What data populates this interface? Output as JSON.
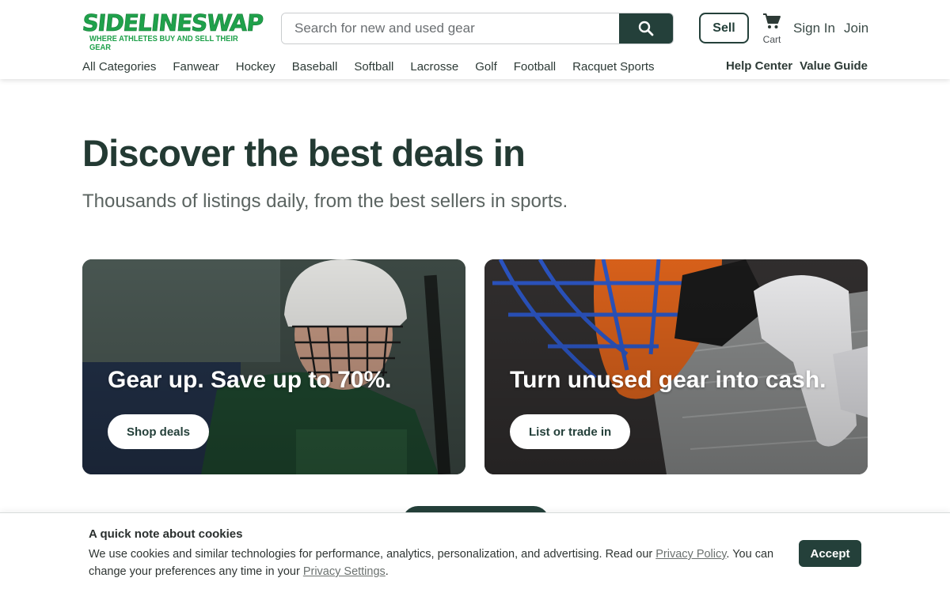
{
  "header": {
    "logo_text": "SIDELINESWAP",
    "logo_tagline": "WHERE ATHLETES BUY AND SELL THEIR GEAR",
    "search_placeholder": "Search for new and used gear",
    "sell_label": "Sell",
    "cart_label": "Cart",
    "signin_label": "Sign In",
    "join_label": "Join"
  },
  "nav": {
    "categories": [
      "All Categories",
      "Fanwear",
      "Hockey",
      "Baseball",
      "Softball",
      "Lacrosse",
      "Golf",
      "Football",
      "Racquet Sports"
    ],
    "right_links": [
      "Help Center",
      "Value Guide"
    ]
  },
  "hero": {
    "title": "Discover the best deals in",
    "subtitle": "Thousands of listings daily, from the best sellers in sports."
  },
  "cards": [
    {
      "title": "Gear up. Save up to 70%.",
      "button": "Shop deals"
    },
    {
      "title": "Turn unused gear into cash.",
      "button": "List or trade in"
    }
  ],
  "cookie": {
    "title": "A quick note about cookies",
    "text_before_policy": "We use cookies and similar technologies for performance, analytics, personalization, and advertising. Read our ",
    "privacy_policy_link": "Privacy Policy",
    "text_middle": ". You can change your preferences any time in your ",
    "privacy_settings_link": "Privacy Settings",
    "text_end": ".",
    "accept_label": "Accept"
  },
  "colors": {
    "brand_green": "#1fa14b",
    "primary_dark": "#24403a",
    "heading": "#233a33"
  },
  "icons": {
    "search": "search-icon",
    "cart": "cart-icon"
  }
}
